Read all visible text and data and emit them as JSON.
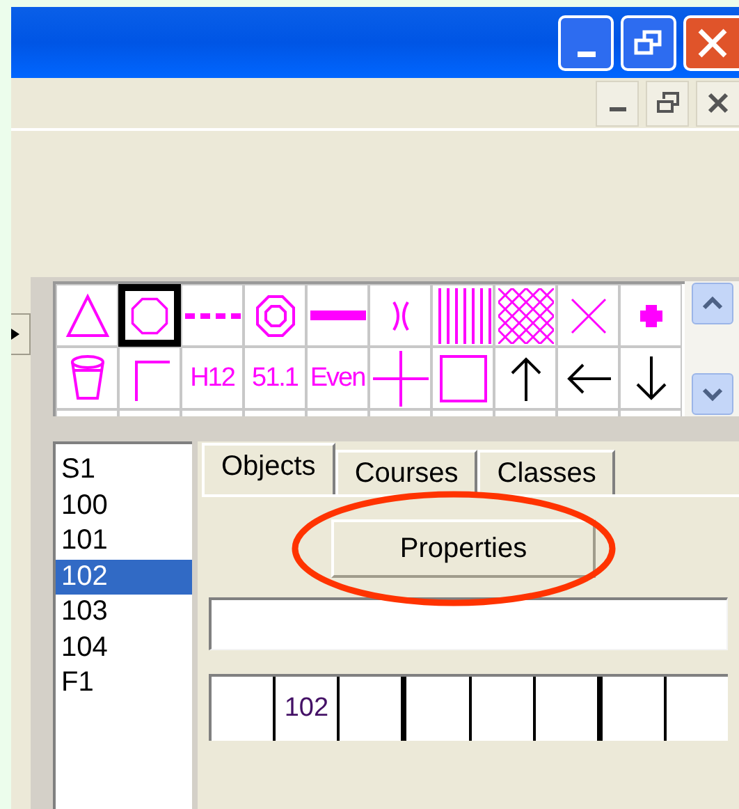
{
  "palette": {
    "cells": [
      {
        "kind": "triangle",
        "selected": false
      },
      {
        "kind": "octagon",
        "selected": true
      },
      {
        "kind": "dashed-line",
        "selected": false
      },
      {
        "kind": "double-octagon",
        "selected": false
      },
      {
        "kind": "thick-line",
        "selected": false
      },
      {
        "kind": "bracket",
        "selected": false
      },
      {
        "kind": "vertical-hatch",
        "selected": false
      },
      {
        "kind": "cross-hatch",
        "selected": false
      },
      {
        "kind": "cross",
        "selected": false
      },
      {
        "kind": "plus",
        "selected": false
      },
      {
        "kind": "cup",
        "selected": false
      },
      {
        "kind": "corner",
        "selected": false
      },
      {
        "kind": "text",
        "label": "H12",
        "selected": false
      },
      {
        "kind": "text",
        "label": "51.1",
        "selected": false
      },
      {
        "kind": "text",
        "label": "Even",
        "selected": false
      },
      {
        "kind": "thin-plus",
        "selected": false
      },
      {
        "kind": "square",
        "selected": false
      },
      {
        "kind": "arrow-up",
        "selected": false
      },
      {
        "kind": "arrow-left",
        "selected": false
      },
      {
        "kind": "arrow-down",
        "selected": false
      }
    ]
  },
  "object_list": [
    {
      "label": "S1",
      "selected": false
    },
    {
      "label": "100",
      "selected": false
    },
    {
      "label": "101",
      "selected": false
    },
    {
      "label": "102",
      "selected": true
    },
    {
      "label": "103",
      "selected": false
    },
    {
      "label": "104",
      "selected": false
    },
    {
      "label": "F1",
      "selected": false
    }
  ],
  "tabs": [
    {
      "label": "Objects",
      "selected": true
    },
    {
      "label": "Courses",
      "selected": false
    },
    {
      "label": "Classes",
      "selected": false
    }
  ],
  "properties_button": {
    "label": "Properties"
  },
  "strip_cells": [
    {
      "text": "",
      "strong_left": false
    },
    {
      "text": "102",
      "strong_left": false
    },
    {
      "text": "",
      "strong_left": false
    },
    {
      "text": "",
      "strong_left": true
    },
    {
      "text": "",
      "strong_left": false
    },
    {
      "text": "",
      "strong_left": false
    },
    {
      "text": "",
      "strong_left": true
    },
    {
      "text": "",
      "strong_left": false
    }
  ]
}
